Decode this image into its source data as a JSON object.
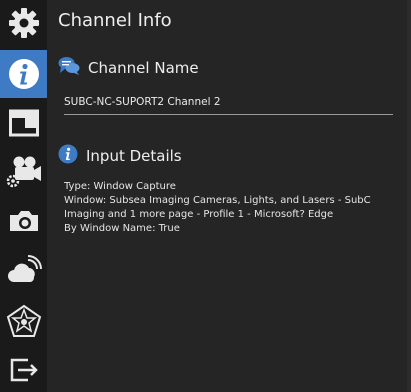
{
  "sidebar": {
    "items": [
      {
        "icon": "gear-icon",
        "active": false
      },
      {
        "icon": "info-icon",
        "active": true
      },
      {
        "icon": "layout-icon",
        "active": false
      },
      {
        "icon": "camera-settings-icon",
        "active": false
      },
      {
        "icon": "camera-icon",
        "active": false
      },
      {
        "icon": "cloud-broadcast-icon",
        "active": false
      },
      {
        "icon": "pentagon-star-icon",
        "active": false
      },
      {
        "icon": "exit-icon",
        "active": false
      }
    ]
  },
  "panel": {
    "title": "Channel Info",
    "channel_name": {
      "label": "Channel Name",
      "value": "SUBC-NC-SUPORT2 Channel 2"
    },
    "input_details": {
      "label": "Input Details",
      "type_line": "Type: Window Capture",
      "window_line": "Window: Subsea Imaging Cameras, Lights, and Lasers - SubC Imaging and 1 more page - Profile 1 - Microsoft? Edge",
      "by_name_line": "By Window Name: True"
    }
  },
  "colors": {
    "accent": "#3e7bc4",
    "sidebar_bg": "#1a1a1a",
    "panel_bg": "#252525"
  }
}
